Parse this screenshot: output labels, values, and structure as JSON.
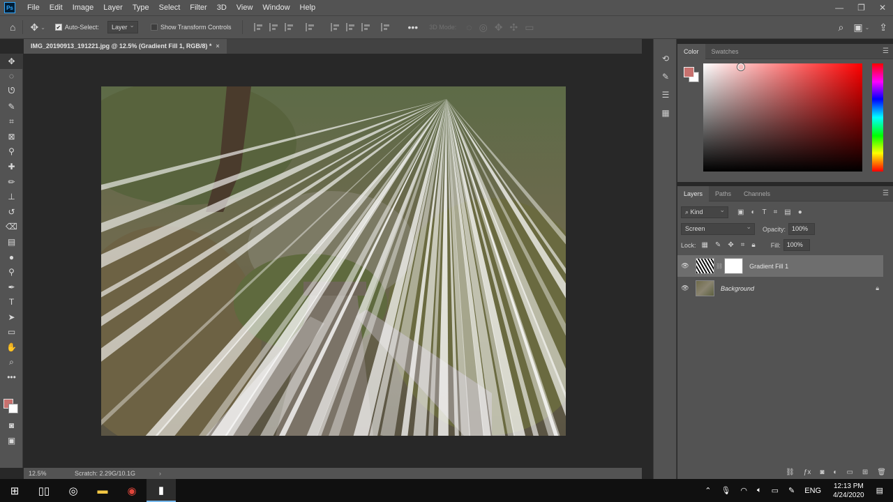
{
  "menubar": {
    "logo": "Ps",
    "items": [
      "File",
      "Edit",
      "Image",
      "Layer",
      "Type",
      "Select",
      "Filter",
      "3D",
      "View",
      "Window",
      "Help"
    ],
    "window_controls": [
      "—",
      "❐",
      "✕"
    ]
  },
  "options": {
    "auto_select_label": "Auto-Select:",
    "auto_select_checked": true,
    "target_value": "Layer",
    "show_transform_label": "Show Transform Controls",
    "show_transform_checked": false,
    "mode_3d_label": "3D Mode:"
  },
  "document": {
    "tab_title": "IMG_20190913_191221.jpg @ 12.5% (Gradient Fill 1, RGB/8) *",
    "tab_close": "×"
  },
  "statusbar": {
    "zoom": "12.5%",
    "scratch": "Scratch: 2.29G/10.1G",
    "arrow": "›"
  },
  "color_panel": {
    "tabs": [
      "Color",
      "Swatches"
    ],
    "active_tab": "Color",
    "foreground": "#c8716e",
    "background": "#ffffff"
  },
  "layers_panel": {
    "tabs": [
      "Layers",
      "Paths",
      "Channels"
    ],
    "active_tab": "Layers",
    "filter_kind": "Kind",
    "blend_mode": "Screen",
    "opacity_label": "Opacity:",
    "opacity_value": "100%",
    "lock_label": "Lock:",
    "fill_label": "Fill:",
    "fill_value": "100%",
    "layers": [
      {
        "name": "Gradient Fill 1",
        "selected": true,
        "italic": false,
        "locked": false
      },
      {
        "name": "Background",
        "selected": false,
        "italic": true,
        "locked": true
      }
    ]
  },
  "taskbar": {
    "language": "ENG",
    "time": "12:13 PM",
    "date": "4/24/2020"
  }
}
